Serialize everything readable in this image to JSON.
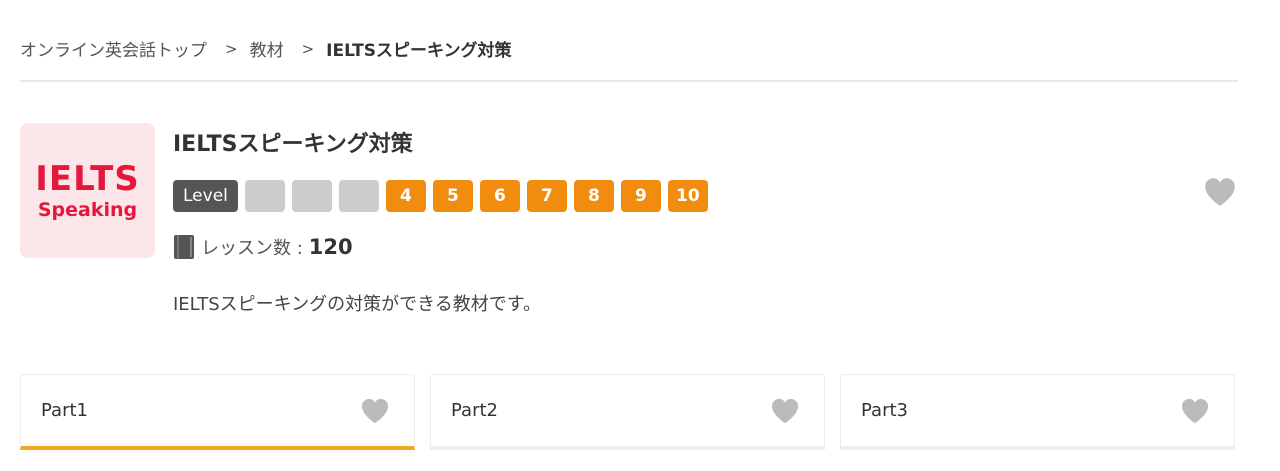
{
  "breadcrumb": {
    "items": [
      "オンライン英会話トップ",
      "教材"
    ],
    "separator": ">",
    "current": "IELTSスピーキング対策"
  },
  "course": {
    "thumbnail": {
      "line1": "IELTS",
      "line2": "Speaking"
    },
    "title": "IELTSスピーキング対策",
    "level": {
      "label": "Level",
      "inactive_count": 3,
      "active_levels": [
        "4",
        "5",
        "6",
        "7",
        "8",
        "9",
        "10"
      ]
    },
    "lessons_label": "レッスン数 :",
    "lessons_count": "120",
    "description": "IELTSスピーキングの対策ができる教材です。"
  },
  "tabs": [
    {
      "label": "Part1",
      "active": true
    },
    {
      "label": "Part2",
      "active": false
    },
    {
      "label": "Part3",
      "active": false
    }
  ],
  "icons": {
    "favorite": "heart-icon",
    "lessons": "book-icon"
  },
  "colors": {
    "level_active": "#f28c0f",
    "level_inactive": "#cccccc",
    "level_tag": "#555555",
    "thumb_bg": "#fde6ea",
    "thumb_text": "#e3183c",
    "tab_active_underline": "#f5a623",
    "heart": "#bbbbbb"
  }
}
